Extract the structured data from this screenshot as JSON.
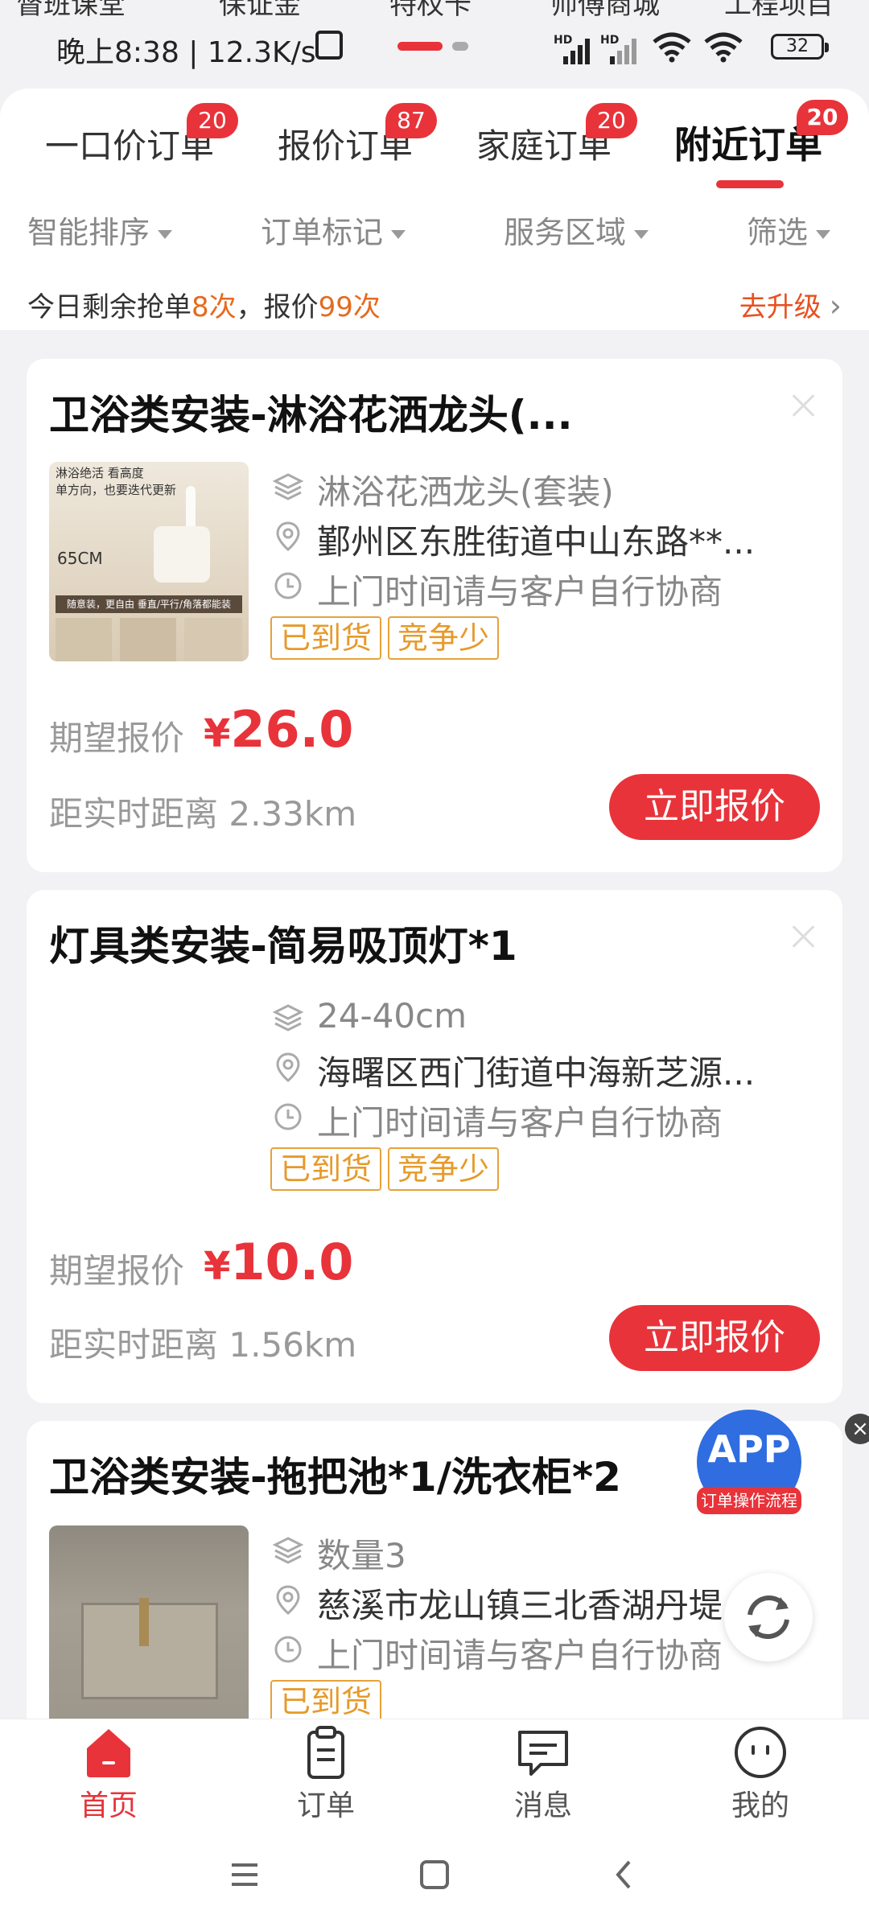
{
  "top_residual": [
    "督班课堂",
    "保证金",
    "特权卡",
    "师傅商城",
    "工程项目"
  ],
  "status_bar": {
    "time_speed": "晚上8:38 | 12.3K/s",
    "battery": "32",
    "signal1": "HD",
    "signal2": "HD"
  },
  "tabs": [
    {
      "label": "一口价订单",
      "badge": "20"
    },
    {
      "label": "报价订单",
      "badge": "87"
    },
    {
      "label": "家庭订单",
      "badge": "20"
    },
    {
      "label": "附近订单",
      "badge": "20"
    }
  ],
  "filters": [
    "智能排序",
    "订单标记",
    "服务区域",
    "筛选"
  ],
  "quota": {
    "prefix": "今日剩余抢单",
    "grab_count": "8次",
    "middle": "，报价",
    "quote_count": "99次",
    "upgrade": "去升级"
  },
  "orders": [
    {
      "title": "卫浴类安装-淋浴花洒龙头(...",
      "spec": "淋浴花洒龙头(套装)",
      "address": "鄞州区东胜街道中山东路**...",
      "time": "上门时间请与客户自行协商",
      "tags": [
        "已到货",
        "竞争少"
      ],
      "price_label": "期望报价",
      "price": "26.0",
      "currency": "¥",
      "distance": "距实时距离 2.33km",
      "button": "立即报价",
      "thumb_text": {
        "line1": "淋浴绝活 看高度",
        "line2": "单方向，也要迭代更新",
        "size": "65CM",
        "bottom": "随意装，更自由 垂直/平行/角落都能装"
      }
    },
    {
      "title": "灯具类安装-简易吸顶灯*1",
      "spec": "24-40cm",
      "address": "海曙区西门街道中海新芝源...",
      "time": "上门时间请与客户自行协商",
      "tags": [
        "已到货",
        "竞争少"
      ],
      "price_label": "期望报价",
      "price": "10.0",
      "currency": "¥",
      "distance": "距实时距离 1.56km",
      "button": "立即报价"
    },
    {
      "title": "卫浴类安装-拖把池*1/洗衣柜*2",
      "spec": "数量3",
      "address": "慈溪市龙山镇三北香湖丹堤",
      "time": "上门时间请与客户自行协商",
      "tags": [
        "已到货"
      ]
    }
  ],
  "float_app": {
    "label": "APP",
    "sub": "订单操作流程"
  },
  "bottom_nav": [
    {
      "label": "首页",
      "active": true,
      "icon": "home-icon"
    },
    {
      "label": "订单",
      "active": false,
      "icon": "clipboard-icon"
    },
    {
      "label": "消息",
      "active": false,
      "icon": "message-icon"
    },
    {
      "label": "我的",
      "active": false,
      "icon": "profile-icon"
    }
  ],
  "colors": {
    "accent": "#e8333a",
    "tag": "#e6a23a",
    "highlight": "#e66a1f",
    "app_blue": "#2f6de0"
  }
}
